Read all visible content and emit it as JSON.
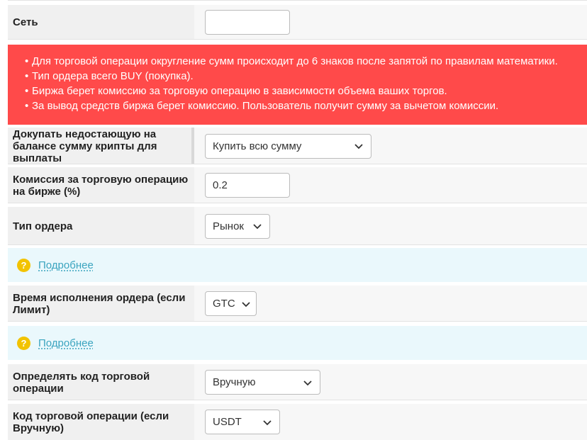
{
  "network": {
    "label": "Сеть",
    "value": ""
  },
  "notice": {
    "items": [
      "Для торговой операции округление сумм происходит до 6 знаков после запятой по правилам математики.",
      "Тип ордера всего BUY (покупка).",
      "Биржа берет комиссию за торговую операцию в зависимости объема ваших торгов.",
      "За вывод средств биржа берет комиссию. Пользователь получит сумму за вычетом комиссии."
    ]
  },
  "buy_missing": {
    "label": "Докупать недостающую на балансе сумму крипты для выплаты",
    "value": "Купить всю сумму"
  },
  "commission": {
    "label": "Комиссия за торговую операцию на бирже (%)",
    "value": "0.2"
  },
  "order_type": {
    "label": "Тип ордера",
    "value": "Рынок"
  },
  "info1": {
    "link": "Подробнее",
    "icon": "?"
  },
  "exec_time": {
    "label": "Время исполнения ордера (если Лимит)",
    "value": "GTC"
  },
  "info2": {
    "link": "Подробнее",
    "icon": "?"
  },
  "code_mode": {
    "label": "Определять код торговой операции",
    "value": "Вручную"
  },
  "trade_code": {
    "label": "Код торговой операции (если Вручную)",
    "value": "USDT"
  }
}
